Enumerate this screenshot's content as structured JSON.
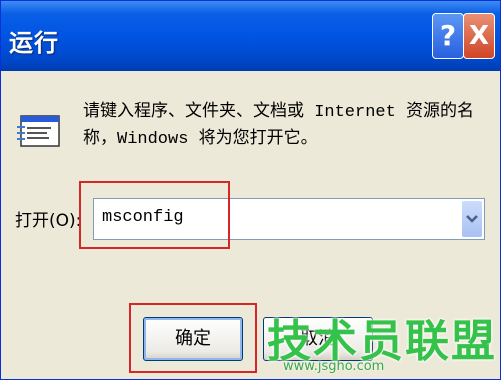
{
  "window": {
    "title": "运行",
    "help_glyph": "?",
    "close_glyph": "X"
  },
  "dialog": {
    "prompt_line1": "请键入程序、文件夹、文档或 Internet 资源的名",
    "prompt_line2": "称，Windows 将为您打开它。",
    "open_label": "打开(O):",
    "open_value": "msconfig",
    "ok_label": "确定",
    "cancel_label": "取消",
    "icon": "run-program-icon"
  },
  "watermark": {
    "main": "技术员联盟",
    "sub": "www.jsgho.com"
  },
  "colors": {
    "titlebar": "#0054e3",
    "dialog_bg": "#ece9d8",
    "highlight": "#d7262a",
    "watermark": "#35c24a"
  }
}
